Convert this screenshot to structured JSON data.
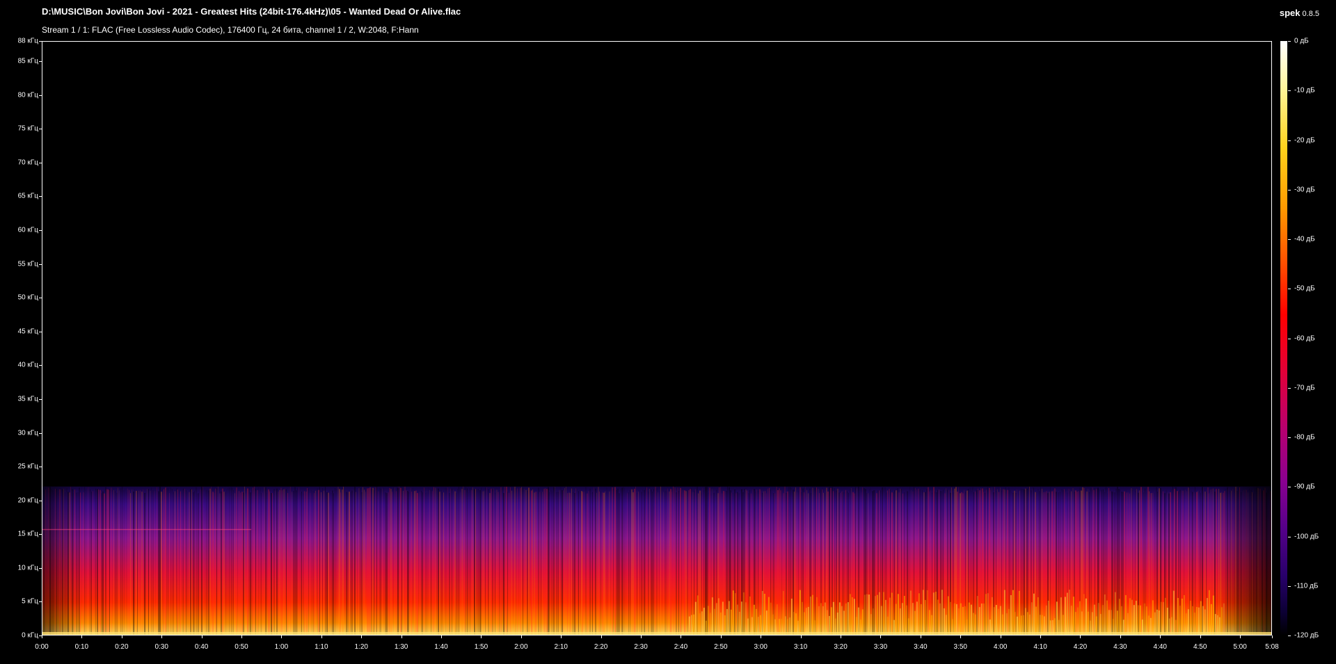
{
  "window": {
    "file_path": "D:\\MUSIC\\Bon Jovi\\Bon Jovi - 2021 - Greatest Hits (24bit-176.4kHz)\\05 - Wanted Dead Or Alive.flac",
    "stream_info": "Stream 1 / 1: FLAC (Free Lossless Audio Codec), 176400 Гц, 24 бита, channel 1 / 2, W:2048, F:Hann",
    "app_name": "spek",
    "app_version": "0.8.5"
  },
  "y_axis": {
    "max_khz": 88,
    "labels": [
      "88 кГц",
      "85 кГц",
      "80 кГц",
      "75 кГц",
      "70 кГц",
      "65 кГц",
      "60 кГц",
      "55 кГц",
      "50 кГц",
      "45 кГц",
      "40 кГц",
      "35 кГц",
      "30 кГц",
      "25 кГц",
      "20 кГц",
      "15 кГц",
      "10 кГц",
      "5 кГц",
      "0 кГц"
    ],
    "values": [
      88,
      85,
      80,
      75,
      70,
      65,
      60,
      55,
      50,
      45,
      40,
      35,
      30,
      25,
      20,
      15,
      10,
      5,
      0
    ]
  },
  "x_axis": {
    "duration_sec": 308,
    "labels": [
      "0:00",
      "0:10",
      "0:20",
      "0:30",
      "0:40",
      "0:50",
      "1:00",
      "1:10",
      "1:20",
      "1:30",
      "1:40",
      "1:50",
      "2:00",
      "2:10",
      "2:20",
      "2:30",
      "2:40",
      "2:50",
      "3:00",
      "3:10",
      "3:20",
      "3:30",
      "3:40",
      "3:50",
      "4:00",
      "4:10",
      "4:20",
      "4:30",
      "4:40",
      "4:50",
      "5:00",
      "5:08"
    ],
    "values": [
      0,
      10,
      20,
      30,
      40,
      50,
      60,
      70,
      80,
      90,
      100,
      110,
      120,
      130,
      140,
      150,
      160,
      170,
      180,
      190,
      200,
      210,
      220,
      230,
      240,
      250,
      260,
      270,
      280,
      290,
      300,
      308
    ]
  },
  "colorbar": {
    "labels": [
      "0 дБ",
      "-10 дБ",
      "-20 дБ",
      "-30 дБ",
      "-40 дБ",
      "-50 дБ",
      "-60 дБ",
      "-70 дБ",
      "-80 дБ",
      "-90 дБ",
      "-100 дБ",
      "-110 дБ",
      "-120 дБ"
    ],
    "values": [
      0,
      -10,
      -20,
      -30,
      -40,
      -50,
      -60,
      -70,
      -80,
      -90,
      -100,
      -110,
      -120
    ],
    "min_db": -120,
    "max_db": 0
  },
  "spectrogram": {
    "cutoff_khz": 22,
    "colors": {
      "background": "#000000",
      "purple": "#3a0a8c",
      "magenta": "#9a1a9a",
      "red": "#ff1010",
      "orange": "#ff8a00",
      "yellow": "#ffe060"
    }
  }
}
